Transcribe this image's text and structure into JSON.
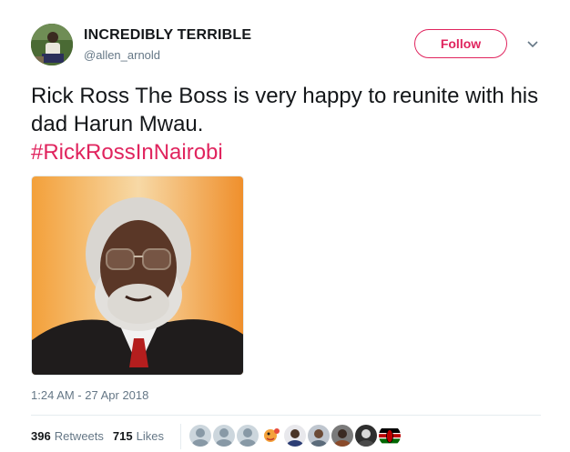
{
  "author": {
    "name": "INCREDIBLY TERRIBLE",
    "handle": "@allen_arnold"
  },
  "follow_label": "Follow",
  "tweet": {
    "text": "Rick Ross The Boss is very happy to reunite with his dad Harun Mwau.",
    "hashtag": "#RickRossInNairobi"
  },
  "timestamp": "1:24 AM - 27 Apr 2018",
  "stats": {
    "retweets_count": "396",
    "retweets_label": "Retweets",
    "likes_count": "715",
    "likes_label": "Likes"
  },
  "colors": {
    "accent": "#e0245e",
    "secondary_text": "#657786",
    "primary_text": "#14171a"
  },
  "icons": {
    "more": "chevron-down-icon"
  }
}
